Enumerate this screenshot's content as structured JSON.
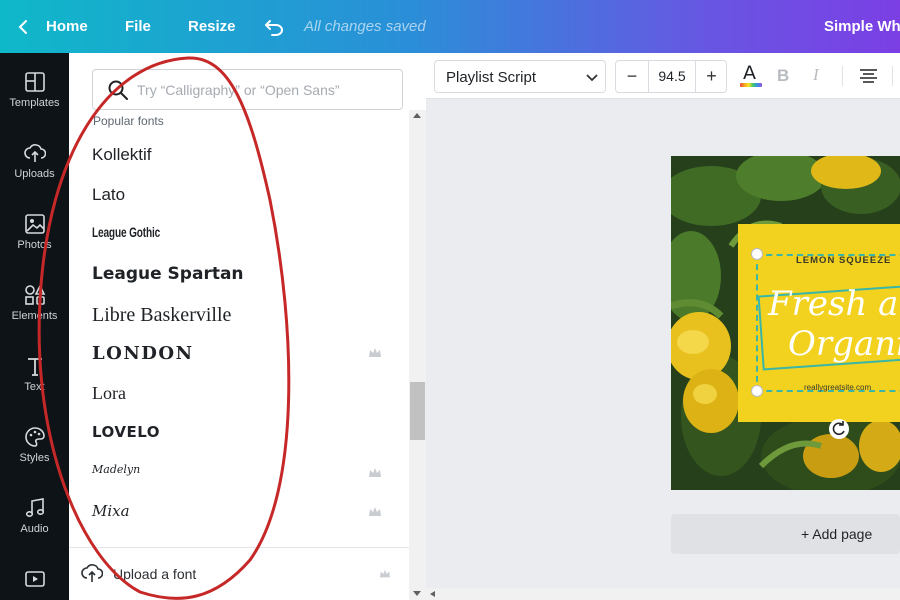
{
  "colors": {
    "topbar_gradient_start": "#0fb8c9",
    "topbar_gradient_end": "#7b3fe4",
    "rail_bg": "#0e1318",
    "annotation": "#c62828",
    "label_yellow": "#f2d21f",
    "label_teal": "#39b6a7"
  },
  "topbar": {
    "back_icon": "chevron-left-icon",
    "home_label": "Home",
    "file_label": "File",
    "resize_label": "Resize",
    "undo_icon": "undo-icon",
    "saved_status": "All changes saved",
    "document_title": "Simple Whi"
  },
  "rail": {
    "items": [
      {
        "label": "Templates",
        "icon": "templates-icon"
      },
      {
        "label": "Uploads",
        "icon": "upload-cloud-icon"
      },
      {
        "label": "Photos",
        "icon": "photo-icon"
      },
      {
        "label": "Elements",
        "icon": "shapes-icon"
      },
      {
        "label": "Text",
        "icon": "text-icon"
      },
      {
        "label": "Styles",
        "icon": "palette-icon"
      },
      {
        "label": "Audio",
        "icon": "music-note-icon"
      },
      {
        "label": "",
        "icon": "video-icon"
      }
    ]
  },
  "font_panel": {
    "search_placeholder": "Try “Calligraphy” or “Open Sans”",
    "section_label": "Popular fonts",
    "fonts": [
      {
        "name": "Kollektif",
        "premium": false
      },
      {
        "name": "Lato",
        "premium": false
      },
      {
        "name": "League Gothic",
        "premium": false
      },
      {
        "name": "League Spartan",
        "premium": false
      },
      {
        "name": "Libre Baskerville",
        "premium": false
      },
      {
        "name": "LONDON",
        "premium": true
      },
      {
        "name": "Lora",
        "premium": false
      },
      {
        "name": "LOVELO",
        "premium": false
      },
      {
        "name": "Madelyn",
        "premium": true
      },
      {
        "name": "Mixa",
        "premium": true
      }
    ],
    "upload_label": "Upload a font",
    "upload_premium": true
  },
  "toolbar": {
    "font_name": "Playlist Script",
    "font_size": "94.5",
    "minus_label": "−",
    "plus_label": "+",
    "color_label": "A",
    "bold_label": "B",
    "italic_label": "I"
  },
  "design": {
    "label_title": "LEMON SQUEEZE",
    "headline_line1": "Fresh and",
    "headline_line2": "Organic",
    "website": "reallygreatsite.com"
  },
  "canvas": {
    "add_page_label": "+ Add page"
  }
}
